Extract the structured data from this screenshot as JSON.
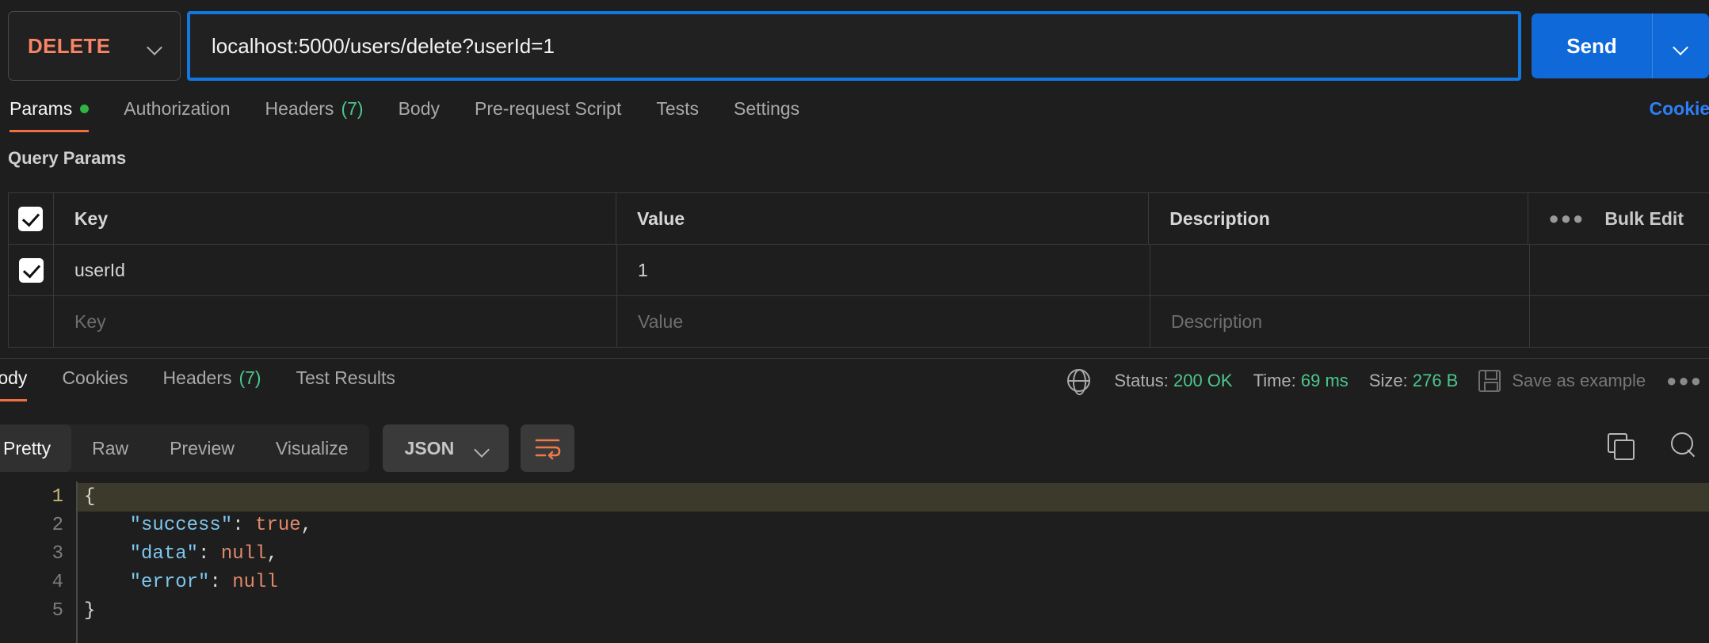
{
  "request": {
    "method": "DELETE",
    "method_color": "#f98466",
    "url": "localhost:5000/users/delete?userId=1",
    "send_label": "Send",
    "send_color": "#1069d8"
  },
  "request_tabs": {
    "items": [
      {
        "label": "Params",
        "badge": "",
        "has_dot": true,
        "active": true
      },
      {
        "label": "Authorization",
        "badge": "",
        "has_dot": false,
        "active": false
      },
      {
        "label": "Headers",
        "badge": "(7)",
        "has_dot": false,
        "active": false
      },
      {
        "label": "Body",
        "badge": "",
        "has_dot": false,
        "active": false
      },
      {
        "label": "Pre-request Script",
        "badge": "",
        "has_dot": false,
        "active": false
      },
      {
        "label": "Tests",
        "badge": "",
        "has_dot": false,
        "active": false
      },
      {
        "label": "Settings",
        "badge": "",
        "has_dot": false,
        "active": false
      }
    ],
    "cookies_link": "Cookies"
  },
  "query_params": {
    "title": "Query Params",
    "columns": [
      "Key",
      "Value",
      "Description"
    ],
    "bulk_edit_label": "Bulk Edit",
    "rows": [
      {
        "checked": true,
        "key": "userId",
        "value": "1",
        "description": ""
      }
    ],
    "empty_row": {
      "key": "Key",
      "value": "Value",
      "description": "Description"
    }
  },
  "response_tabs": {
    "items": [
      {
        "label": "Body",
        "badge": "",
        "active": true
      },
      {
        "label": "Cookies",
        "badge": "",
        "active": false
      },
      {
        "label": "Headers",
        "badge": "(7)",
        "active": false
      },
      {
        "label": "Test Results",
        "badge": "",
        "active": false
      }
    ]
  },
  "response_meta": {
    "status_label": "Status:",
    "status_value": "200 OK",
    "time_label": "Time:",
    "time_value": "69 ms",
    "size_label": "Size:",
    "size_value": "276 B",
    "save_example_label": "Save as example",
    "status_color": "#4cc78a"
  },
  "viewer": {
    "modes": [
      "Pretty",
      "Raw",
      "Preview",
      "Visualize"
    ],
    "active_mode": "Pretty",
    "format": "JSON"
  },
  "response_body": {
    "language": "json",
    "lines": [
      {
        "num": "1",
        "highlighted": true,
        "tokens": [
          {
            "t": "{",
            "c": "punc"
          }
        ]
      },
      {
        "num": "2",
        "highlighted": false,
        "tokens": [
          {
            "t": "    ",
            "c": "punc"
          },
          {
            "t": "\"success\"",
            "c": "key"
          },
          {
            "t": ": ",
            "c": "punc"
          },
          {
            "t": "true",
            "c": "lit"
          },
          {
            "t": ",",
            "c": "punc"
          }
        ]
      },
      {
        "num": "3",
        "highlighted": false,
        "tokens": [
          {
            "t": "    ",
            "c": "punc"
          },
          {
            "t": "\"data\"",
            "c": "key"
          },
          {
            "t": ": ",
            "c": "punc"
          },
          {
            "t": "null",
            "c": "lit"
          },
          {
            "t": ",",
            "c": "punc"
          }
        ]
      },
      {
        "num": "4",
        "highlighted": false,
        "tokens": [
          {
            "t": "    ",
            "c": "punc"
          },
          {
            "t": "\"error\"",
            "c": "key"
          },
          {
            "t": ": ",
            "c": "punc"
          },
          {
            "t": "null",
            "c": "lit"
          }
        ]
      },
      {
        "num": "5",
        "highlighted": false,
        "tokens": [
          {
            "t": "}",
            "c": "punc"
          }
        ]
      }
    ],
    "raw": "{\n    \"success\": true,\n    \"data\": null,\n    \"error\": null\n}"
  }
}
